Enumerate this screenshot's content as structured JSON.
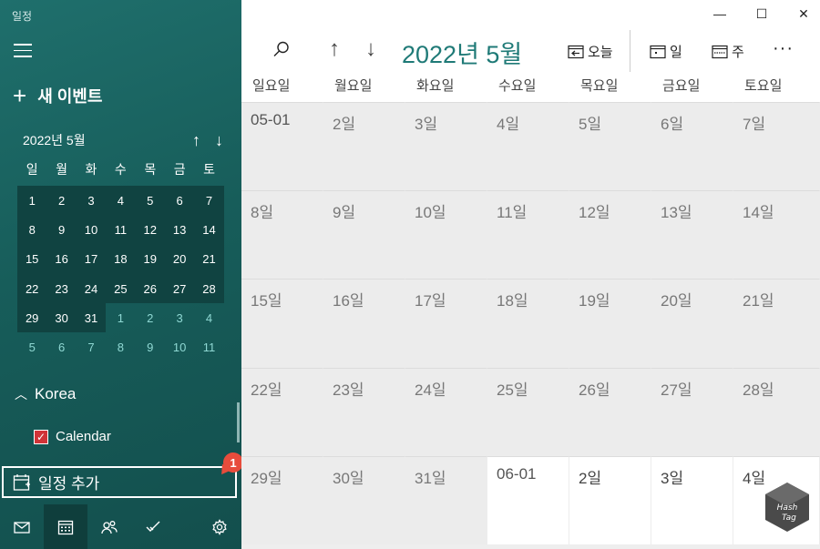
{
  "app": {
    "title": "일정"
  },
  "sidebar": {
    "new_event_label": "새 이벤트",
    "mini_calendar": {
      "title": "2022년 5월",
      "weekdays": [
        "일",
        "월",
        "화",
        "수",
        "목",
        "금",
        "토"
      ],
      "days": [
        {
          "d": "1",
          "cur": true
        },
        {
          "d": "2",
          "cur": true
        },
        {
          "d": "3",
          "cur": true
        },
        {
          "d": "4",
          "cur": true
        },
        {
          "d": "5",
          "cur": true
        },
        {
          "d": "6",
          "cur": true
        },
        {
          "d": "7",
          "cur": true
        },
        {
          "d": "8",
          "cur": true
        },
        {
          "d": "9",
          "cur": true
        },
        {
          "d": "10",
          "cur": true
        },
        {
          "d": "11",
          "cur": true
        },
        {
          "d": "12",
          "cur": true
        },
        {
          "d": "13",
          "cur": true
        },
        {
          "d": "14",
          "cur": true
        },
        {
          "d": "15",
          "cur": true
        },
        {
          "d": "16",
          "cur": true
        },
        {
          "d": "17",
          "cur": true
        },
        {
          "d": "18",
          "cur": true
        },
        {
          "d": "19",
          "cur": true
        },
        {
          "d": "20",
          "cur": true
        },
        {
          "d": "21",
          "cur": true
        },
        {
          "d": "22",
          "cur": true
        },
        {
          "d": "23",
          "cur": true
        },
        {
          "d": "24",
          "cur": true
        },
        {
          "d": "25",
          "cur": true
        },
        {
          "d": "26",
          "cur": true
        },
        {
          "d": "27",
          "cur": true
        },
        {
          "d": "28",
          "cur": true
        },
        {
          "d": "29",
          "cur": true
        },
        {
          "d": "30",
          "cur": true
        },
        {
          "d": "31",
          "cur": true
        },
        {
          "d": "1",
          "cur": false
        },
        {
          "d": "2",
          "cur": false
        },
        {
          "d": "3",
          "cur": false
        },
        {
          "d": "4",
          "cur": false
        },
        {
          "d": "5",
          "cur": false
        },
        {
          "d": "6",
          "cur": false
        },
        {
          "d": "7",
          "cur": false
        },
        {
          "d": "8",
          "cur": false
        },
        {
          "d": "9",
          "cur": false
        },
        {
          "d": "10",
          "cur": false
        },
        {
          "d": "11",
          "cur": false
        }
      ]
    },
    "calendar_group": "Korea",
    "calendar_item": {
      "label": "Calendar",
      "checked": true,
      "color": "#d13438"
    },
    "add_schedule_label": "일정 추가",
    "callout_number": "1",
    "bottom_nav": [
      "mail-icon",
      "calendar-icon",
      "people-icon",
      "todo-icon",
      "settings-icon"
    ]
  },
  "toolbar": {
    "month_title": "2022년 5월",
    "today_label": "오늘",
    "day_label": "일",
    "week_label": "주"
  },
  "month_view": {
    "weekdays": [
      "일요일",
      "월요일",
      "화요일",
      "수요일",
      "목요일",
      "금요일",
      "토요일"
    ],
    "cells": [
      {
        "label": "05-01",
        "next": false,
        "first": true
      },
      {
        "label": "2일",
        "next": false
      },
      {
        "label": "3일",
        "next": false
      },
      {
        "label": "4일",
        "next": false
      },
      {
        "label": "5일",
        "next": false
      },
      {
        "label": "6일",
        "next": false
      },
      {
        "label": "7일",
        "next": false
      },
      {
        "label": "8일",
        "next": false
      },
      {
        "label": "9일",
        "next": false
      },
      {
        "label": "10일",
        "next": false
      },
      {
        "label": "11일",
        "next": false
      },
      {
        "label": "12일",
        "next": false
      },
      {
        "label": "13일",
        "next": false
      },
      {
        "label": "14일",
        "next": false
      },
      {
        "label": "15일",
        "next": false
      },
      {
        "label": "16일",
        "next": false
      },
      {
        "label": "17일",
        "next": false
      },
      {
        "label": "18일",
        "next": false
      },
      {
        "label": "19일",
        "next": false
      },
      {
        "label": "20일",
        "next": false
      },
      {
        "label": "21일",
        "next": false
      },
      {
        "label": "22일",
        "next": false
      },
      {
        "label": "23일",
        "next": false
      },
      {
        "label": "24일",
        "next": false
      },
      {
        "label": "25일",
        "next": false
      },
      {
        "label": "26일",
        "next": false
      },
      {
        "label": "27일",
        "next": false
      },
      {
        "label": "28일",
        "next": false
      },
      {
        "label": "29일",
        "next": false
      },
      {
        "label": "30일",
        "next": false
      },
      {
        "label": "31일",
        "next": false
      },
      {
        "label": "06-01",
        "next": true,
        "first": true
      },
      {
        "label": "2일",
        "next": true
      },
      {
        "label": "3일",
        "next": true
      },
      {
        "label": "4일",
        "next": true
      }
    ]
  },
  "colors": {
    "sidebar": "#1a6562",
    "accent": "#1f7a77",
    "callout": "#e74c3c"
  }
}
